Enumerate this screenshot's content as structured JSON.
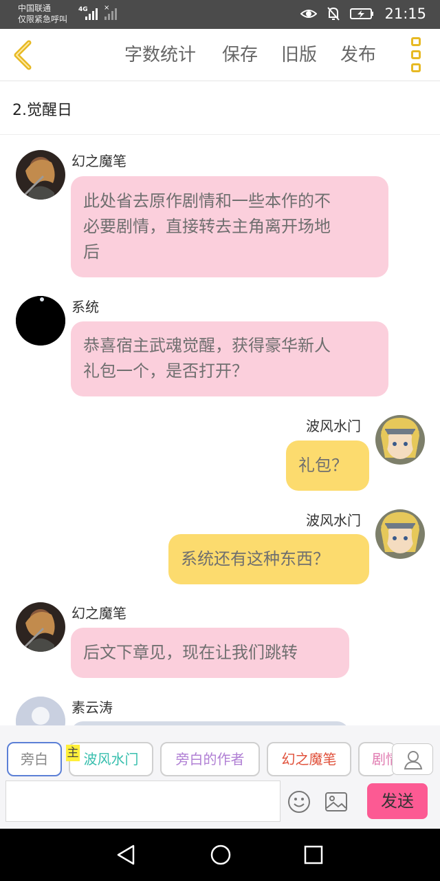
{
  "status_bar": {
    "carrier_line1": "中国联通",
    "carrier_line2": "仅限紧急呼叫",
    "network": "4G",
    "time": "21:15",
    "icons": [
      "eye-icon",
      "mute-icon",
      "battery-charging-icon"
    ]
  },
  "toolbar": {
    "back_icon": "chevron-left-icon",
    "word_count": "字数统计",
    "save": "保存",
    "old_version": "旧版",
    "publish": "发布",
    "menu_icon": "more-vertical-icon",
    "accent": "#e7b923"
  },
  "chapter": {
    "title": "2.觉醒日"
  },
  "messages": [
    {
      "sender": "幻之魔笔",
      "text_lines": [
        "此处省去原作剧情和一些本作的不",
        "必要剧情，直接转去主角离开场地",
        "后"
      ],
      "side": "left",
      "color": "#fbcfdc"
    },
    {
      "sender": "系统",
      "text_lines": [
        "恭喜宿主武魂觉醒，获得豪华新人",
        "礼包一个，是否打开？"
      ],
      "side": "left",
      "color": "#fbcfdc"
    },
    {
      "sender": "波风水门",
      "text_lines": [
        "礼包？"
      ],
      "side": "right",
      "color": "#fcdb6e"
    },
    {
      "sender": "波风水门",
      "text_lines": [
        "系统还有这种东西？"
      ],
      "side": "right",
      "color": "#fcdb6e"
    },
    {
      "sender": "幻之魔笔",
      "text_lines": [
        "后文下章见，现在让我们跳转"
      ],
      "side": "left",
      "color": "#fbcfdc"
    },
    {
      "sender": "素云涛",
      "text_lines": [
        ""
      ],
      "side": "left",
      "color": "#d4dae6"
    }
  ],
  "roles": [
    {
      "label": "旁白",
      "color": "#888888",
      "border": "#5b7fd6",
      "selected": true
    },
    {
      "label": "波风水门",
      "color": "#38bfae",
      "border": "#cfcfcf",
      "tag": "主"
    },
    {
      "label": "旁白的作者",
      "color": "#b07fd4",
      "border": "#cfcfcf"
    },
    {
      "label": "幻之魔笔",
      "color": "#e0503a",
      "border": "#cfcfcf"
    },
    {
      "label": "剧情",
      "color": "#e07ab0",
      "border": "#cfcfcf"
    }
  ],
  "input": {
    "value": "",
    "placeholder": "",
    "emoji_icon": "emoji-icon",
    "image_icon": "image-icon",
    "send": "发送",
    "send_color": "#fc5a93",
    "profile_icon": "user-icon"
  },
  "nav_bar": {
    "icons": [
      "back-triangle-icon",
      "home-circle-icon",
      "recents-square-icon"
    ]
  }
}
